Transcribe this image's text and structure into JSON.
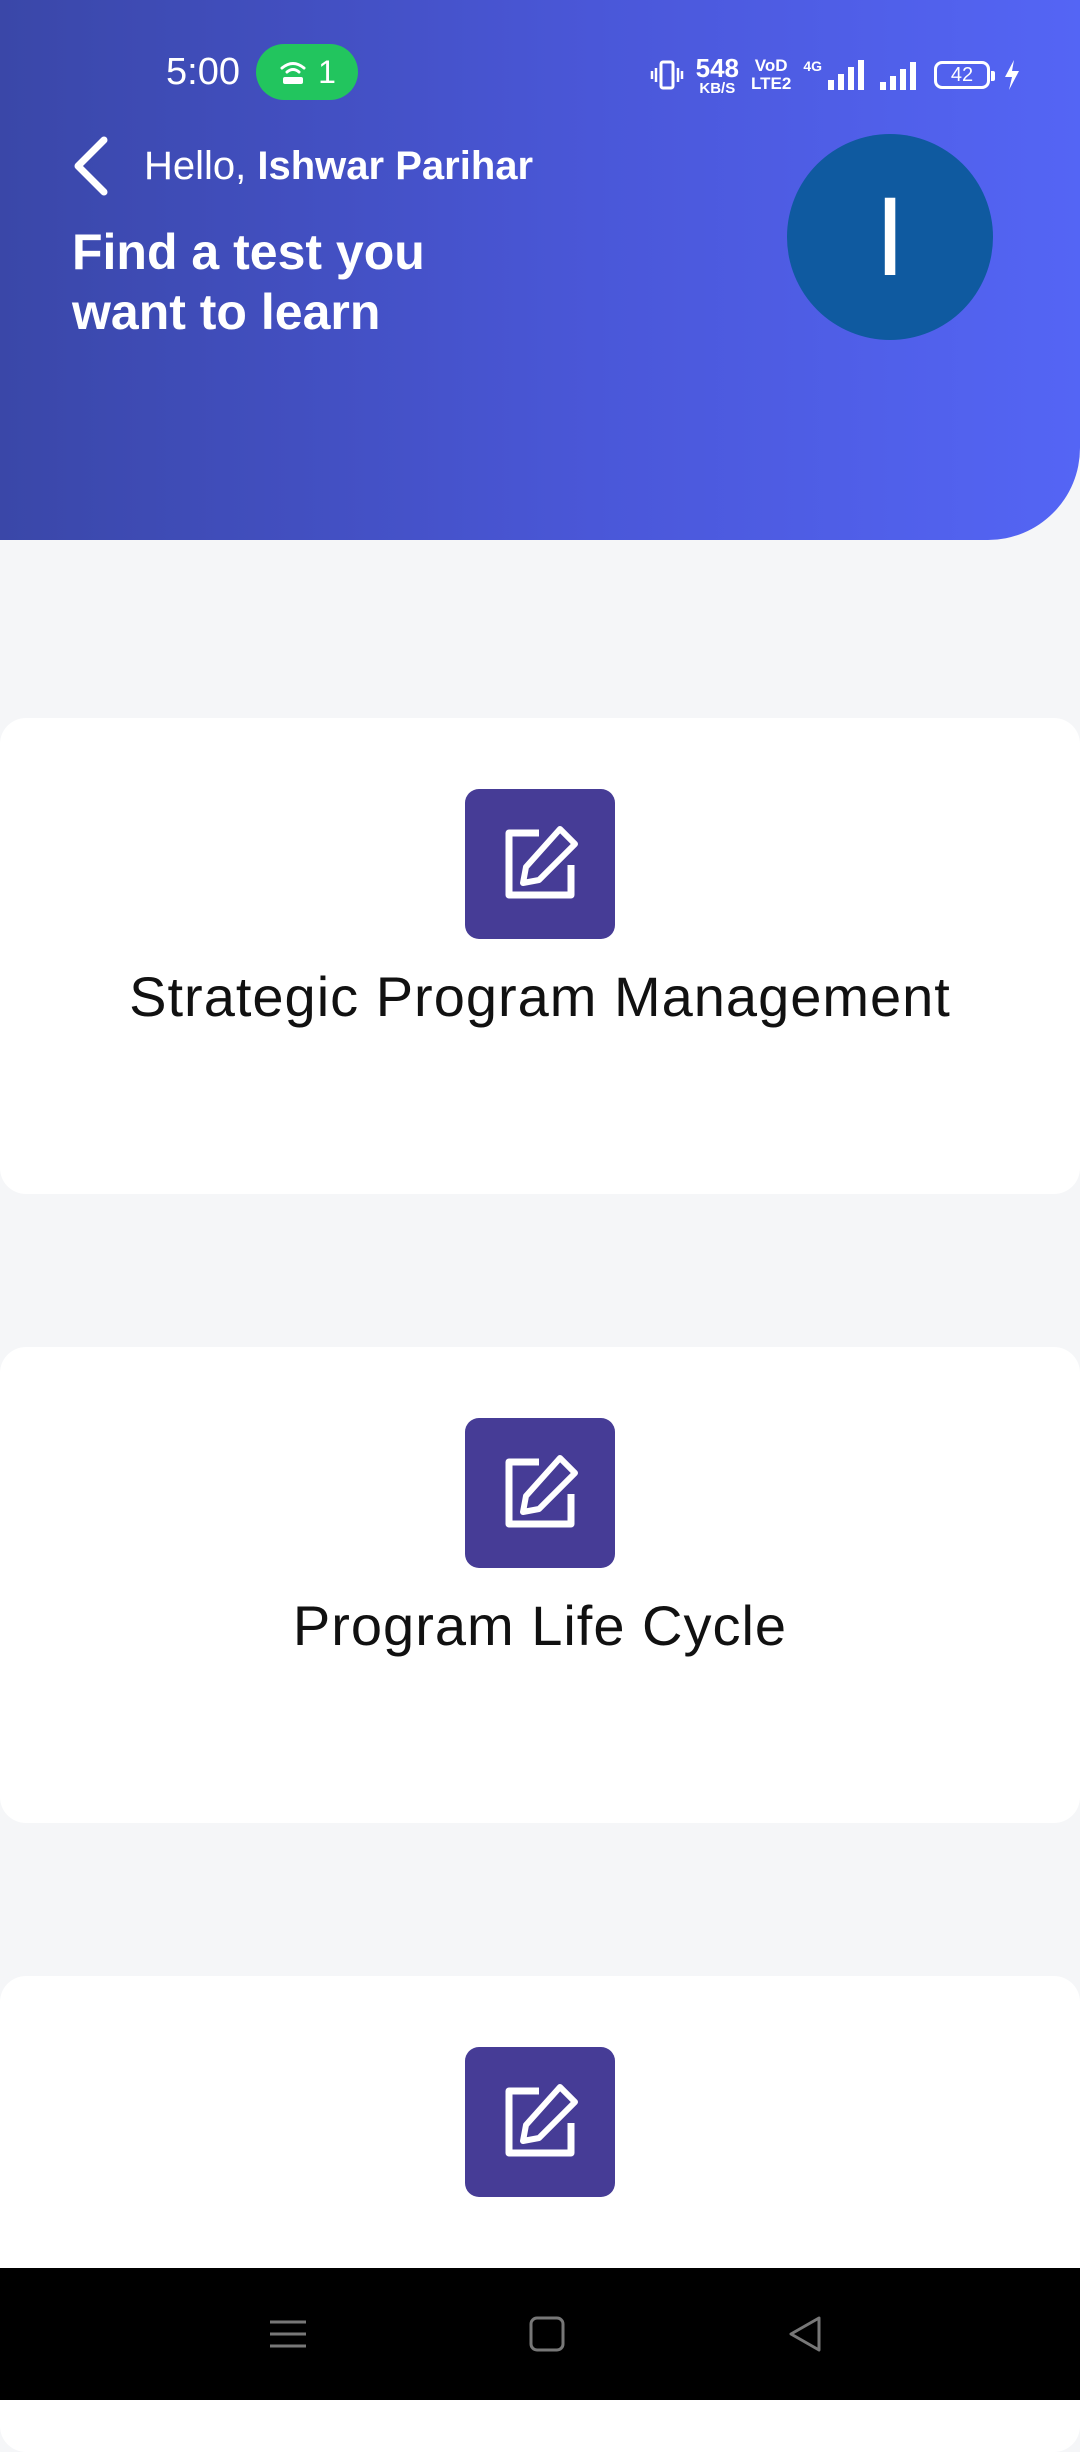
{
  "status_bar": {
    "time": "5:00",
    "hotspot_count": "1",
    "net_speed_value": "548",
    "net_speed_unit": "KB/S",
    "volte_line1": "VoD",
    "volte_line2": "LTE2",
    "network_type": "4G",
    "battery_level": "42"
  },
  "header": {
    "greeting_prefix": "Hello, ",
    "user_name": "Ishwar Parihar",
    "subtitle": "Find a test you want to learn",
    "avatar_initial": "I"
  },
  "tests": [
    {
      "title": "Strategic Program Management",
      "icon": "edit-icon"
    },
    {
      "title": "Program Life Cycle",
      "icon": "edit-icon"
    },
    {
      "title": "",
      "icon": "edit-icon"
    }
  ],
  "colors": {
    "header_gradient_start": "#3a47a8",
    "header_gradient_end": "#5465f5",
    "icon_tile": "#463c96",
    "avatar_bg": "#0f5aa0",
    "hotspot_pill": "#22c55e"
  }
}
